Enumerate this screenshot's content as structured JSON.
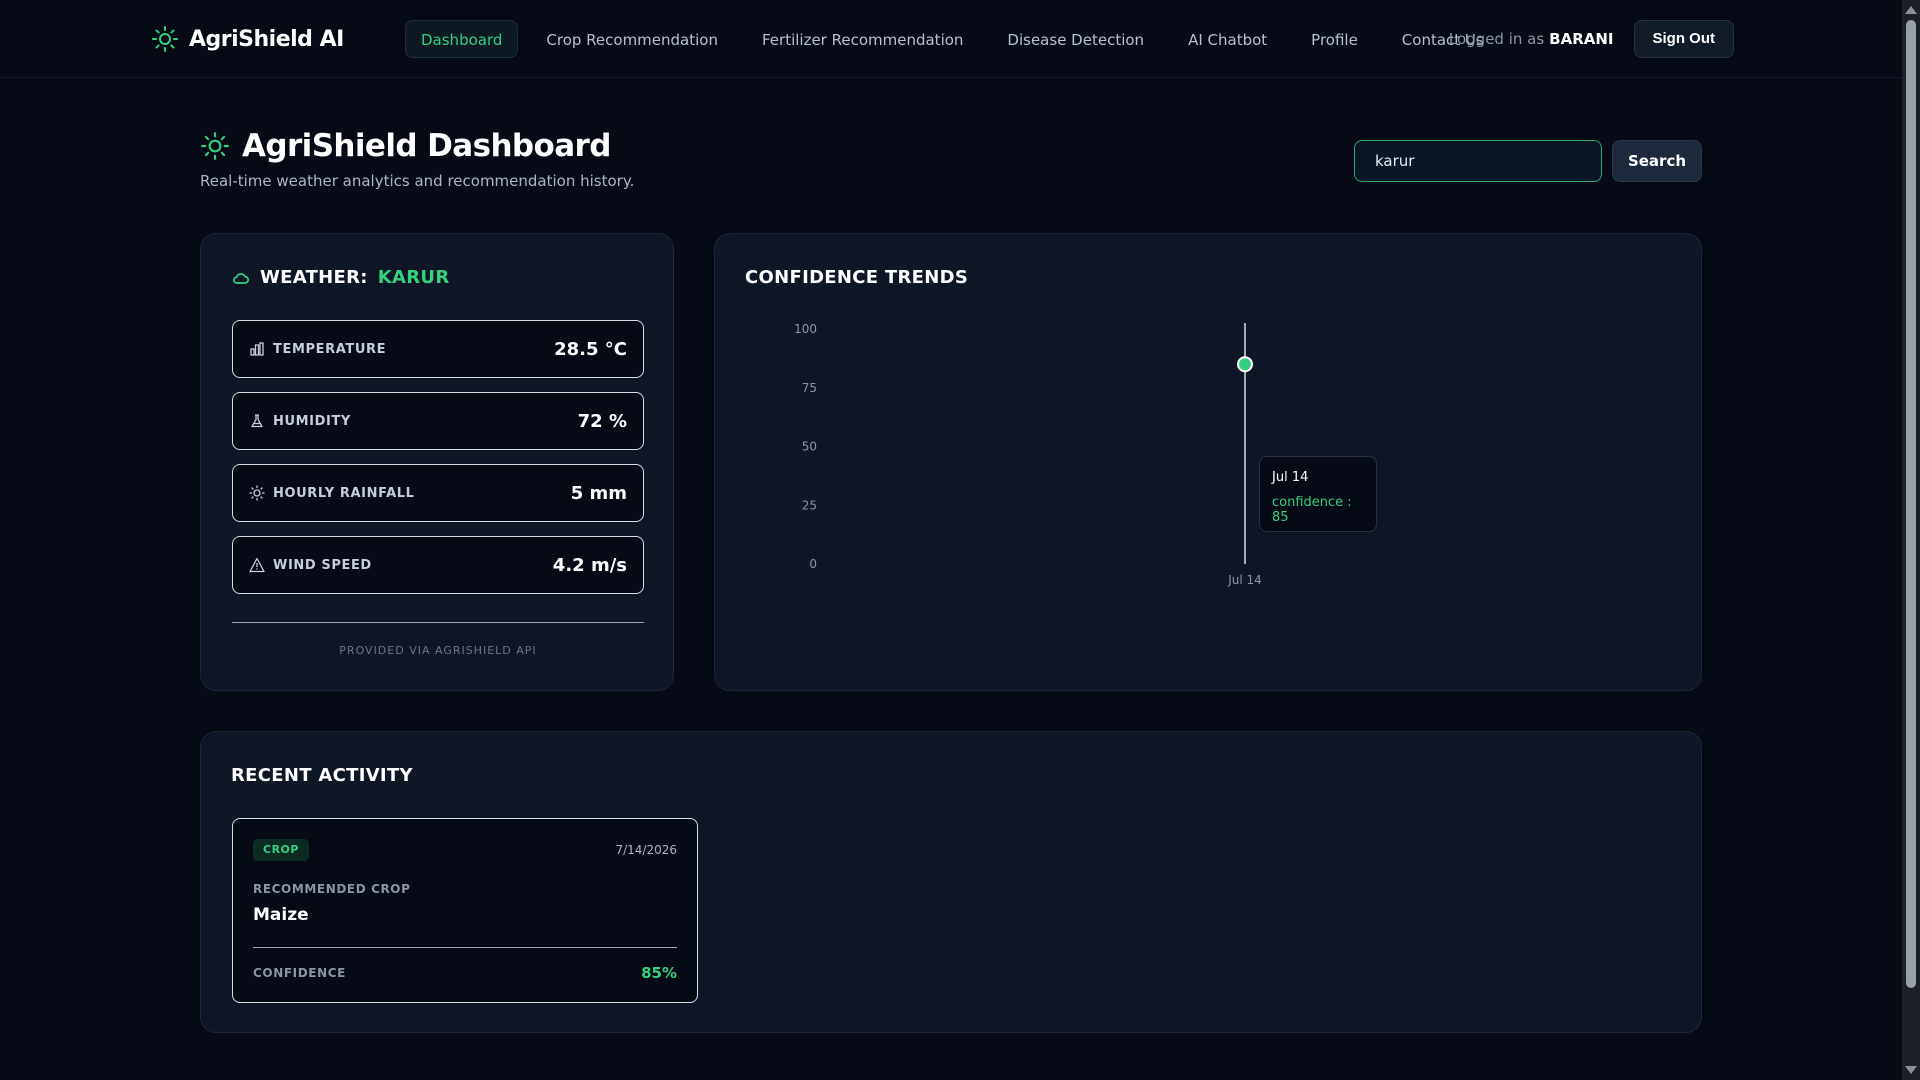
{
  "app": {
    "name": "AgriShield AI"
  },
  "nav": {
    "items": [
      {
        "label": "Dashboard",
        "active": true
      },
      {
        "label": "Crop Recommendation",
        "active": false
      },
      {
        "label": "Fertilizer Recommendation",
        "active": false
      },
      {
        "label": "Disease Detection",
        "active": false
      },
      {
        "label": "AI Chatbot",
        "active": false
      },
      {
        "label": "Profile",
        "active": false
      },
      {
        "label": "Contact Us",
        "active": false
      }
    ],
    "logged_in_label": "Logged in as",
    "user": "BARANI",
    "signout_label": "Sign Out"
  },
  "header": {
    "title": "AgriShield Dashboard",
    "subtitle": "Real-time weather analytics and recommendation history.",
    "search_value": "karur",
    "search_button": "Search"
  },
  "weather": {
    "heading": "WEATHER:",
    "city": "KARUR",
    "metrics": [
      {
        "label": "TEMPERATURE",
        "value": "28.5 °C",
        "icon": "thermometer-icon"
      },
      {
        "label": "HUMIDITY",
        "value": "72 %",
        "icon": "flask-icon"
      },
      {
        "label": "HOURLY RAINFALL",
        "value": "5 mm",
        "icon": "sun-icon"
      },
      {
        "label": "WIND SPEED",
        "value": "4.2 m/s",
        "icon": "triangle-icon"
      }
    ],
    "footer": "PROVIDED VIA AGRISHIELD API"
  },
  "chart_data": {
    "type": "line",
    "title": "CONFIDENCE TRENDS",
    "xlabel": "",
    "ylabel": "",
    "categories": [
      "Jul 14"
    ],
    "series": [
      {
        "values": [
          85
        ]
      }
    ],
    "ylim": [
      0,
      100
    ],
    "yticks": [
      0,
      25,
      50,
      75,
      100
    ],
    "grid": false,
    "tooltip": {
      "date": "Jul 14",
      "text": "confidence : 85"
    }
  },
  "recent": {
    "title": "RECENT ACTIVITY",
    "items": [
      {
        "badge": "CROP",
        "date": "7/14/2026",
        "label": "RECOMMENDED CROP",
        "value": "Maize",
        "confidence_label": "CONFIDENCE",
        "confidence": "85%"
      }
    ]
  },
  "colors": {
    "accent": "#34d17f",
    "background": "#050a14",
    "card": "#0f1726"
  }
}
